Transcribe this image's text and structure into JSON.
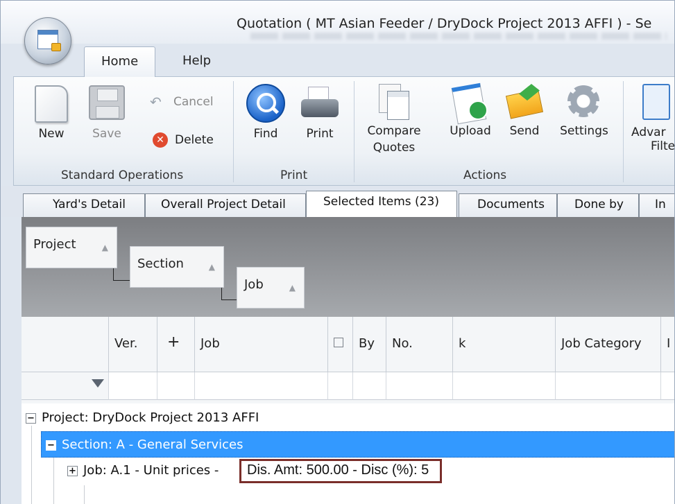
{
  "window": {
    "title": "Quotation ( MT Asian Feeder / DryDock Project 2013 AFFI ) - Se"
  },
  "ribbon_tabs": [
    "Home",
    "Help"
  ],
  "ribbon": {
    "standard_operations": {
      "label": "Standard Operations",
      "new": "New",
      "save": "Save",
      "cancel": "Cancel",
      "delete": "Delete"
    },
    "print_group": {
      "label": "Print",
      "find": "Find",
      "print": "Print"
    },
    "actions": {
      "label": "Actions",
      "compare_line1": "Compare",
      "compare_line2": "Quotes",
      "upload": "Upload",
      "send": "Send",
      "settings": "Settings"
    },
    "advanced": {
      "line1": "Advar",
      "line2": "Filte"
    }
  },
  "doc_tabs": [
    "Yard's Detail",
    "Overall Project Detail",
    "Selected Items (23)",
    "Documents",
    "Done by",
    "In"
  ],
  "group_panel": {
    "levels": [
      "Project",
      "Section",
      "Job"
    ]
  },
  "grid": {
    "columns": [
      "Ver.",
      "+",
      "Job",
      "",
      "By",
      "No.",
      "k",
      "Job Category",
      "I"
    ]
  },
  "tree": {
    "project": "Project:  DryDock Project 2013 AFFI",
    "section": "Section:  A - General Services",
    "job": "Job:  A.1 - Unit prices  -",
    "job_highlight": "Dis. Amt: 500.00 - Disc (%): 5"
  },
  "colors": {
    "selection": "#3399ff",
    "highlight_border": "#7a2e2a"
  }
}
